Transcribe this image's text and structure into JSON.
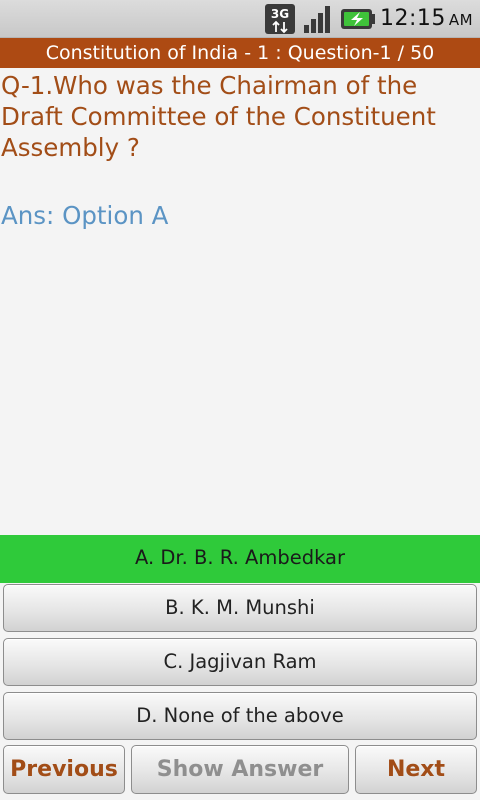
{
  "status_bar": {
    "time": "12:15",
    "ampm": "AM",
    "icons": [
      "3g-data-icon",
      "signal-strength-icon",
      "battery-charging-icon"
    ]
  },
  "header": {
    "title": "Constitution of India - 1 : Question-1 / 50"
  },
  "question": {
    "text": "Q-1.Who was the Chairman of the Draft Committee of the Constituent Assembly ?",
    "answer": "Ans: Option A"
  },
  "options": [
    {
      "label": "A. Dr. B. R. Ambedkar",
      "state": "correct"
    },
    {
      "label": "B. K. M. Munshi",
      "state": "normal"
    },
    {
      "label": "C. Jagjivan Ram",
      "state": "normal"
    },
    {
      "label": "D. None of the above",
      "state": "normal"
    }
  ],
  "navigation": {
    "previous_label": "Previous",
    "show_answer_label": "Show Answer",
    "next_label": "Next"
  },
  "colors": {
    "title_bar": "#ad4a13",
    "question_text": "#a24d17",
    "answer_text": "#5b94c4",
    "correct_option": "#2fca3a",
    "nav_text": "#a24d17",
    "disabled_text": "#8f8f8f"
  }
}
